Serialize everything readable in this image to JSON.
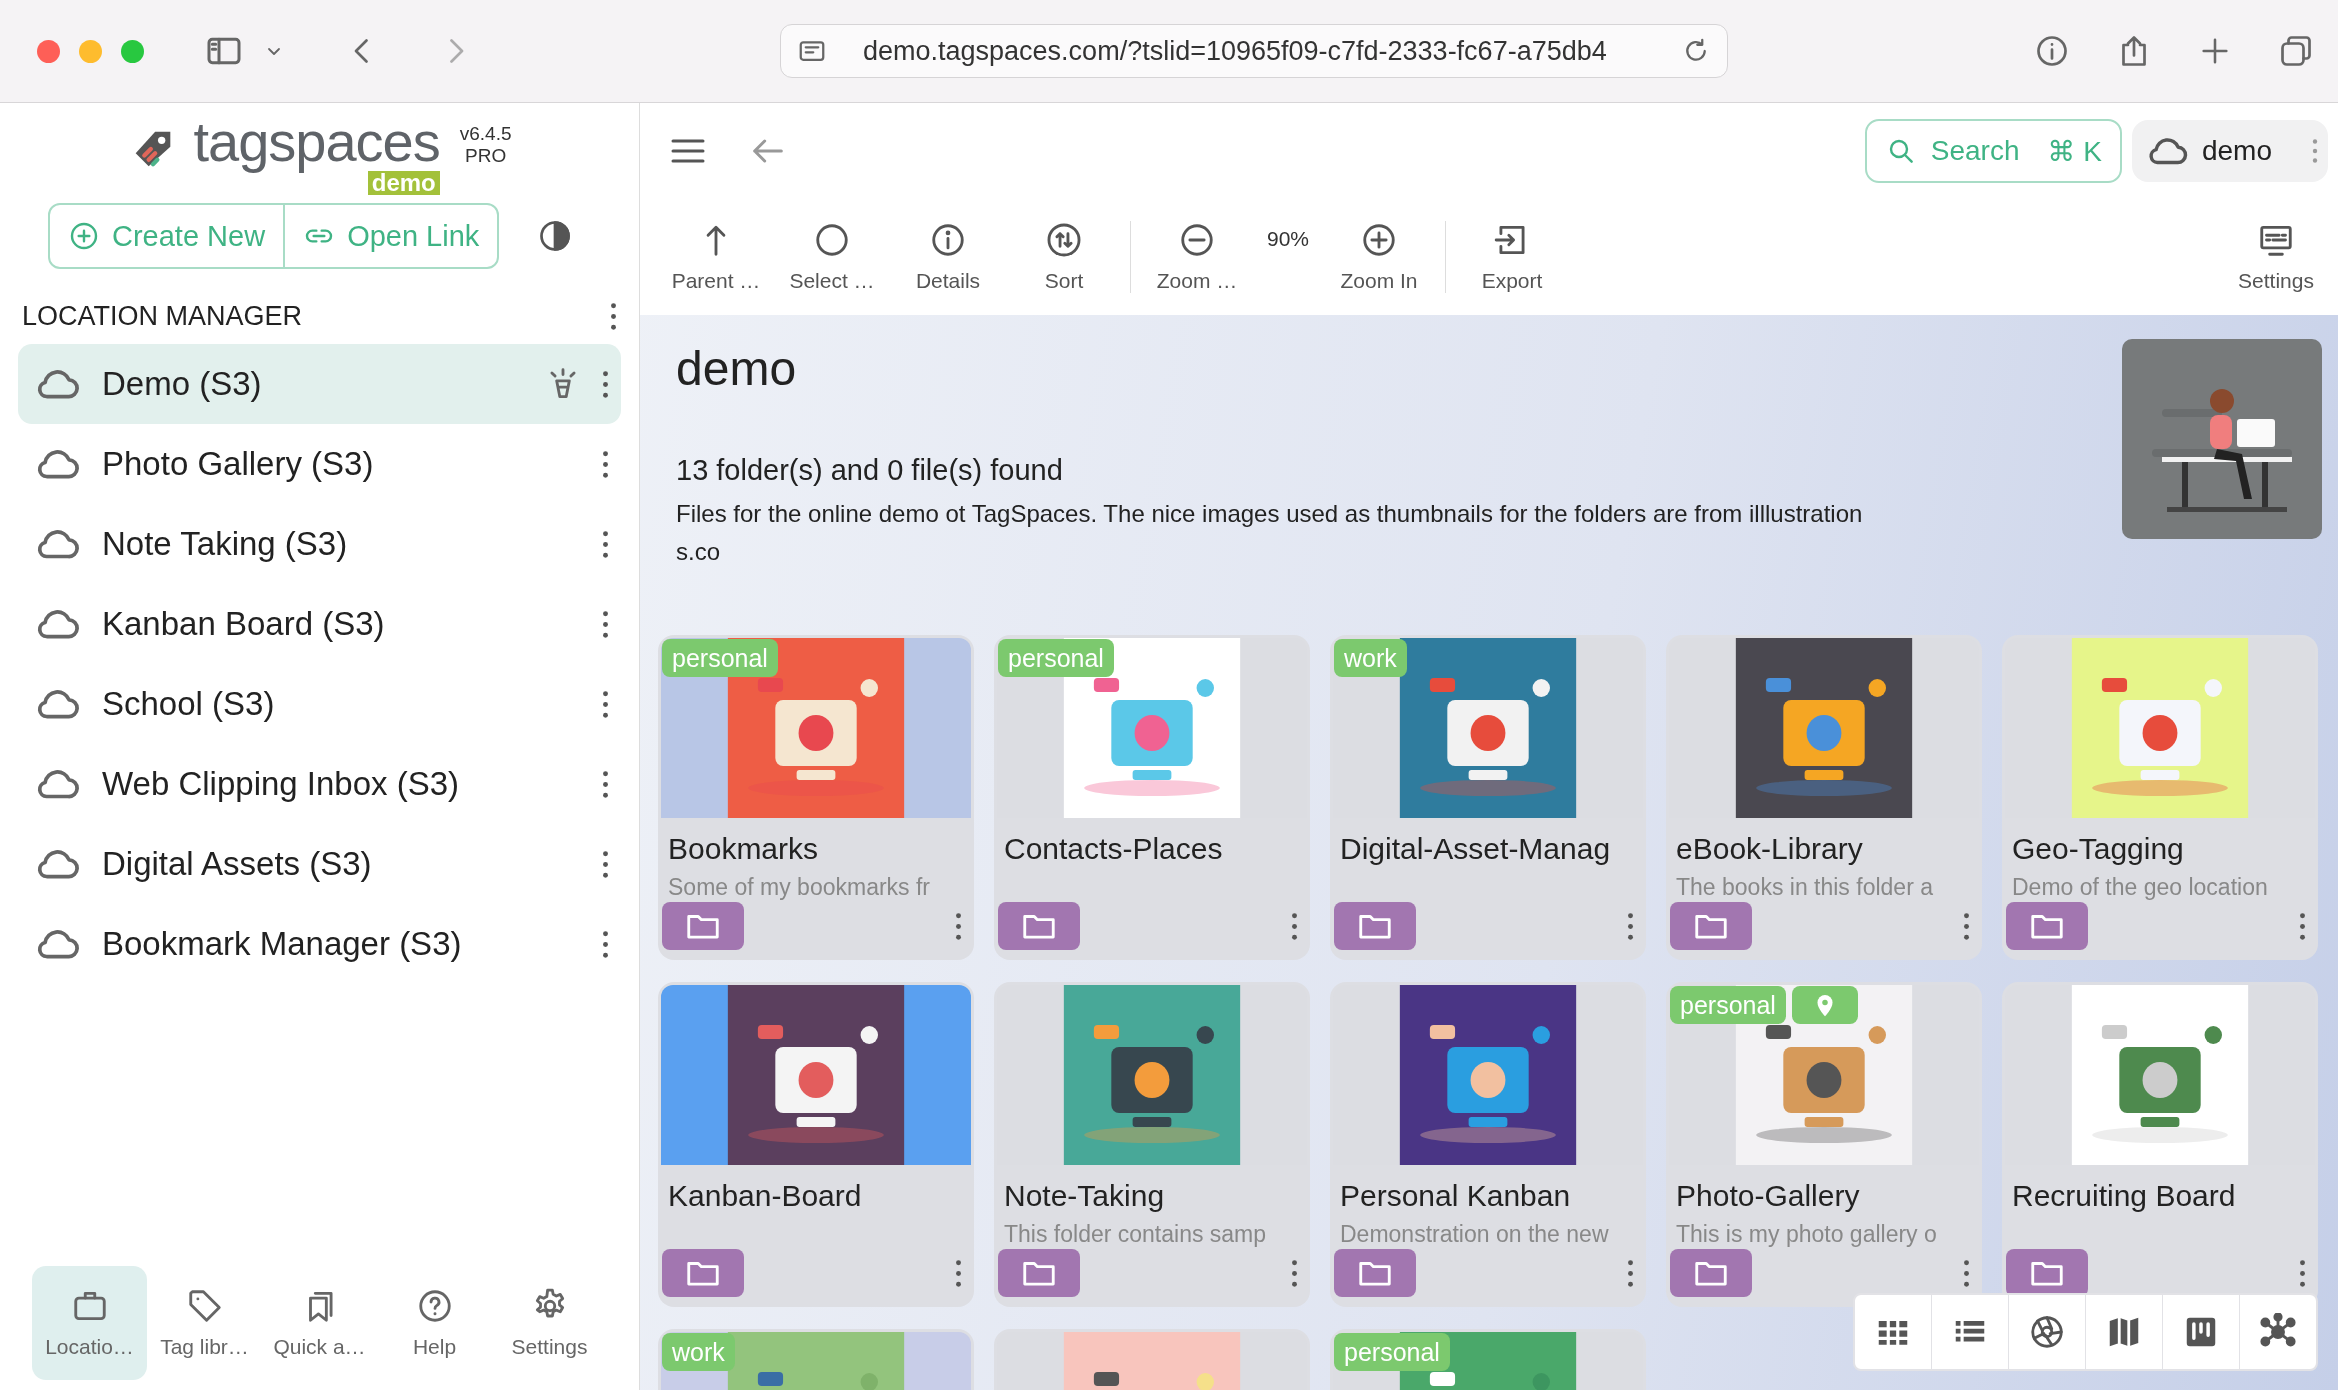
{
  "browser": {
    "url": "demo.tagspaces.com/?tslid=10965f09-c7fd-2333-fc67-a75db4"
  },
  "sidebar": {
    "logo": "tagspaces",
    "logo_badge": "demo",
    "version": "v6.4.5",
    "edition": "PRO",
    "actions": [
      {
        "kind": "create",
        "label": "Create New"
      },
      {
        "kind": "link",
        "label": "Open Link"
      }
    ],
    "section_title": "LOCATION MANAGER",
    "locations": [
      {
        "name": "Demo (S3)",
        "selected": true,
        "default": true
      },
      {
        "name": "Photo Gallery (S3)",
        "selected": false,
        "default": false
      },
      {
        "name": "Note Taking (S3)",
        "selected": false,
        "default": false
      },
      {
        "name": "Kanban Board (S3)",
        "selected": false,
        "default": false
      },
      {
        "name": "School (S3)",
        "selected": false,
        "default": false
      },
      {
        "name": "Web Clipping Inbox (S3)",
        "selected": false,
        "default": false
      },
      {
        "name": "Digital Assets (S3)",
        "selected": false,
        "default": false
      },
      {
        "name": "Bookmark Manager (S3)",
        "selected": false,
        "default": false
      }
    ],
    "nav": [
      {
        "kind": "locations",
        "label": "Locatio…",
        "selected": true
      },
      {
        "kind": "tags",
        "label": "Tag libr…",
        "selected": false
      },
      {
        "kind": "quick",
        "label": "Quick a…",
        "selected": false
      },
      {
        "kind": "help",
        "label": "Help",
        "selected": false
      },
      {
        "kind": "settings",
        "label": "Settings",
        "selected": false
      }
    ]
  },
  "header": {
    "search": "Search",
    "shortcut": "⌘ K",
    "account": "demo"
  },
  "toolbar": [
    {
      "kind": "parent",
      "label": "Parent …"
    },
    {
      "kind": "select",
      "label": "Select …"
    },
    {
      "kind": "details",
      "label": "Details"
    },
    {
      "kind": "sort",
      "label": "Sort"
    },
    {
      "kind": "divider"
    },
    {
      "kind": "zoom-out",
      "label": "Zoom …"
    },
    {
      "kind": "zoom-level",
      "label": "90%"
    },
    {
      "kind": "zoom-in",
      "label": "Zoom In"
    },
    {
      "kind": "divider"
    },
    {
      "kind": "export",
      "label": "Export"
    },
    {
      "kind": "settings",
      "label": "Settings"
    }
  ],
  "folder": {
    "title": "demo",
    "summary": "13 folder(s) and 0 file(s) found",
    "description": [
      "Files for the online demo ot TagSpaces. The nice images used as thumbnails for the folders are from illlustration",
      "s.co"
    ]
  },
  "cards": [
    {
      "kind": "folder",
      "title": "Bookmarks",
      "description": "Some of my bookmarks fr",
      "tags": [
        {
          "kind": "label",
          "label": "personal"
        }
      ]
    },
    {
      "kind": "folder",
      "title": "Contacts-Places",
      "tags": [
        {
          "kind": "label",
          "label": "personal"
        }
      ]
    },
    {
      "kind": "folder",
      "title": "Digital-Asset-Manag",
      "tags": [
        {
          "kind": "label",
          "label": "work"
        }
      ]
    },
    {
      "kind": "folder",
      "title": "eBook-Library",
      "description": "The books in this folder a"
    },
    {
      "kind": "folder",
      "title": "Geo-Tagging",
      "description": "Demo of the geo location"
    },
    {
      "kind": "folder",
      "title": "Kanban-Board"
    },
    {
      "kind": "folder",
      "title": "Note-Taking",
      "description": "This folder contains samp"
    },
    {
      "kind": "folder",
      "title": "Personal Kanban",
      "description": "Demonstration on the new"
    },
    {
      "kind": "folder",
      "title": "Photo-Gallery",
      "description": "This is my photo gallery o",
      "tags": [
        {
          "kind": "label",
          "label": "personal"
        },
        {
          "kind": "geo"
        }
      ]
    },
    {
      "kind": "folder",
      "title": "Recruiting Board"
    },
    {
      "kind": "partial",
      "tags": [
        {
          "kind": "label",
          "label": "work"
        }
      ]
    },
    {
      "kind": "partial"
    },
    {
      "kind": "partial",
      "tags": [
        {
          "kind": "label",
          "label": "personal"
        }
      ]
    }
  ],
  "view_modes": [
    {
      "kind": "grid"
    },
    {
      "kind": "list"
    },
    {
      "kind": "gallery"
    },
    {
      "kind": "map"
    },
    {
      "kind": "kanban"
    },
    {
      "kind": "graph"
    }
  ]
}
